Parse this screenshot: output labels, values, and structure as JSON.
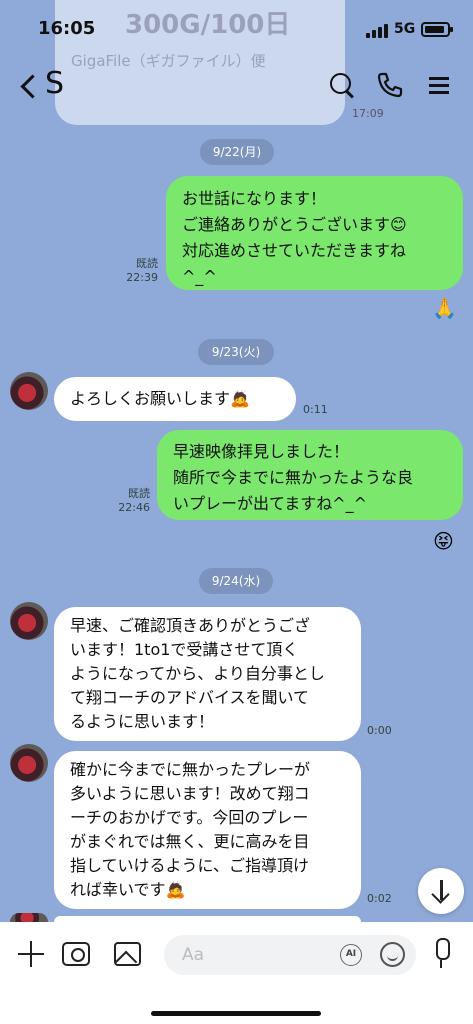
{
  "status": {
    "time": "16:05",
    "network": "5G"
  },
  "header": {
    "title": "S"
  },
  "background_ad": {
    "line1": "300G/100日",
    "line2": "GigaFile（ギガファイル）便",
    "time": "17:09"
  },
  "messages": [
    {
      "type": "date",
      "text": "9/22(月)"
    },
    {
      "type": "out",
      "text": "お世話になります！\nご連絡ありがとうございます😊\n対応進めさせていただきますね\n^_^",
      "read": "既読",
      "time": "22:39",
      "reaction": "🙏"
    },
    {
      "type": "date",
      "text": "9/23(火)"
    },
    {
      "type": "in",
      "text": "よろしくお願いします🙇",
      "time": "0:11"
    },
    {
      "type": "out",
      "text": "早速映像拝見しました！\n随所で今までに無かったような良\nいプレーが出てますね^_^",
      "read": "既読",
      "time": "22:46",
      "reaction": "😝"
    },
    {
      "type": "date",
      "text": "9/24(水)"
    },
    {
      "type": "in",
      "text": "早速、ご確認頂きありがとうござ\nいます！1to1で受講させて頂く\nようになってから、より自分事とし\nて翔コーチのアドバイスを聞いて\nるように思います！",
      "time": "0:00"
    },
    {
      "type": "in",
      "text": "確かに今までに無かったプレーが\n多いように思います！改めて翔コ\nーチのおかげです。今回のプレー\nがまぐれでは無く、更に高みを目\n指していけるように、ご指導頂け\nれば幸いです🙇",
      "time": "0:02"
    }
  ],
  "input": {
    "placeholder": "Aa",
    "ai_label": "AI"
  }
}
